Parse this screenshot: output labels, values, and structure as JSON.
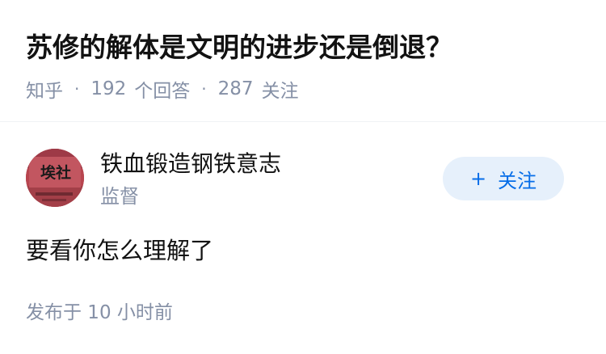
{
  "question": {
    "title": "苏修的解体是文明的进步还是倒退？",
    "meta": {
      "source": "知乎",
      "answers_count": "192",
      "answers_label": "个回答",
      "followers_count": "287",
      "followers_label": "关注",
      "separator": "·"
    }
  },
  "answer": {
    "author": {
      "name": "铁血锻造钢铁意志",
      "headline": "监督",
      "avatar_text": "埃社"
    },
    "follow_button": {
      "icon": "+",
      "label": "关注"
    },
    "content": "要看你怎么理解了",
    "time": "发布于 10 小时前"
  },
  "colors": {
    "primary_text": "#121212",
    "secondary_text": "#8590a6",
    "brand_blue": "#056de8",
    "follow_bg": "#e6f0fb",
    "divider": "#f0f2f5"
  }
}
